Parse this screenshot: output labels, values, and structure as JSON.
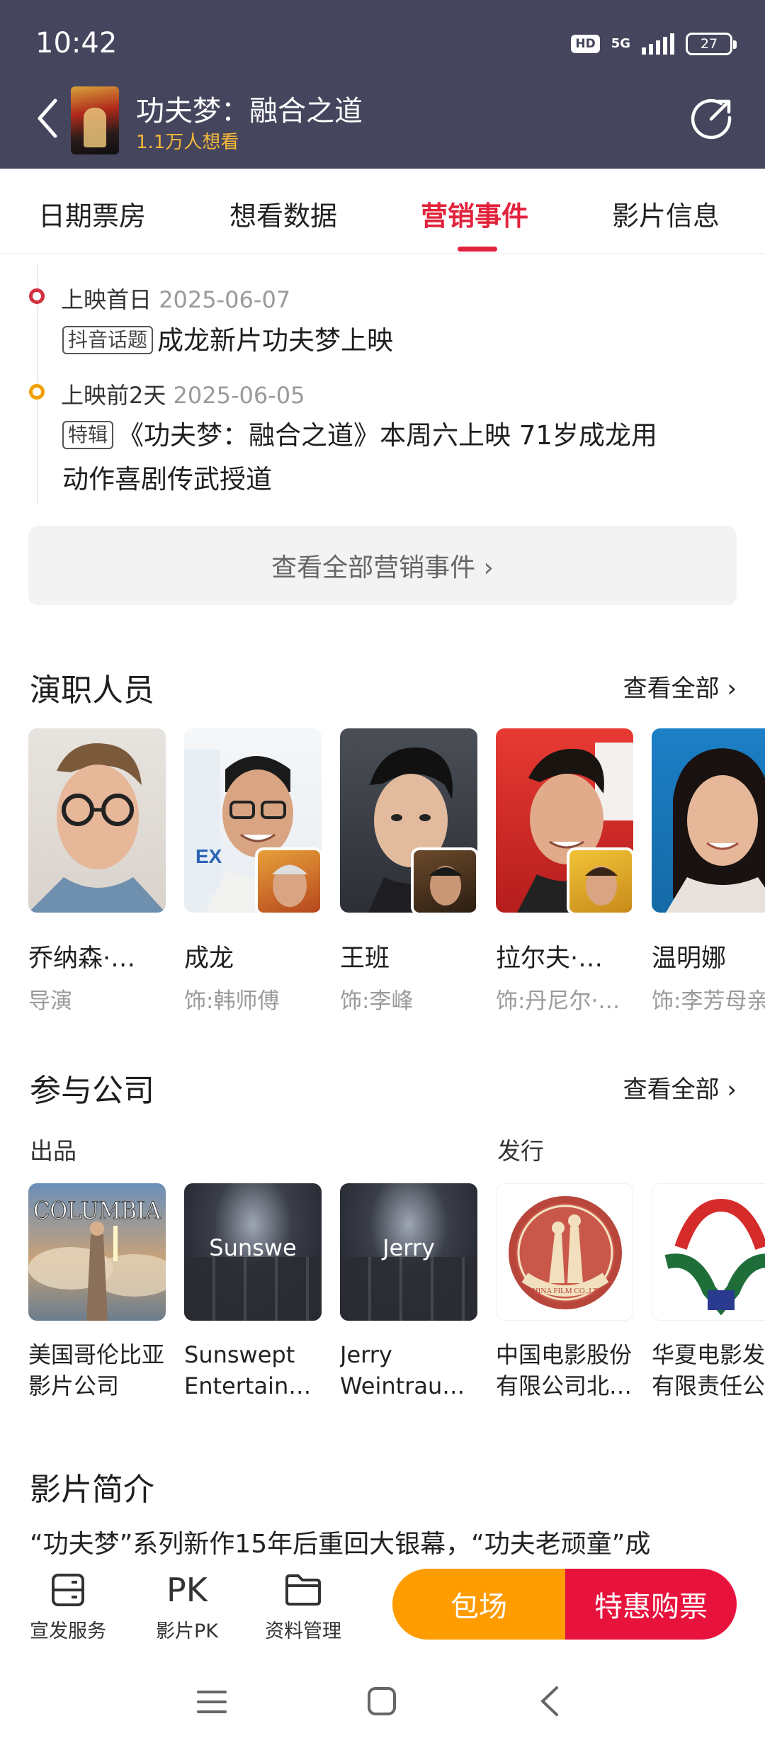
{
  "status_bar": {
    "time": "10:42",
    "network": "5G",
    "battery": "27",
    "hd": "HD"
  },
  "header": {
    "movie_title": "功夫梦：融合之道",
    "want_count": "1.1万人想看"
  },
  "tabs": [
    {
      "label": "日期票房",
      "active": false
    },
    {
      "label": "想看数据",
      "active": false
    },
    {
      "label": "营销事件",
      "active": true
    },
    {
      "label": "影片信息",
      "active": false
    }
  ],
  "events": [
    {
      "stage": "上映首日",
      "date": "2025-06-07",
      "tag": "抖音话题",
      "text": "成龙新片功夫梦上映",
      "dot_color": "#d3303f"
    },
    {
      "stage": "上映前2天",
      "date": "2025-06-05",
      "tag": "特辑",
      "text_line1": "《功夫梦：融合之道》本周六上映 71岁成龙用",
      "text_line2": "动作喜剧传武授道",
      "dot_color": "#f0a000"
    }
  ],
  "view_all_events": "查看全部营销事件 ›",
  "cast_section": {
    "title": "演职人员",
    "view_all": "查看全部 ›",
    "members": [
      {
        "name": "乔纳森·…",
        "role": "导演"
      },
      {
        "name": "成龙",
        "role": "饰:韩师傅"
      },
      {
        "name": "王班",
        "role": "饰:李峰"
      },
      {
        "name": "拉尔夫·…",
        "role": "饰:丹尼尔·…"
      },
      {
        "name": "温明娜",
        "role": "饰:李芳母亲"
      }
    ]
  },
  "company_section": {
    "title": "参与公司",
    "view_all": "查看全部 ›",
    "production_label": "出品",
    "distribution_label": "发行",
    "companies": [
      {
        "line1": "美国哥伦比亚",
        "line2": "影片公司",
        "logo_text": "COLUMBIA"
      },
      {
        "line1": "Sunswept",
        "line2": "Entertain…",
        "logo_text": "Sunswe"
      },
      {
        "line1": "Jerry",
        "line2": "Weintraub…",
        "logo_text": "Jerry"
      },
      {
        "line1": "中国电影股份",
        "line2": "有限公司北…",
        "logo_text": "CHINA FILM CO.,LTD"
      },
      {
        "line1": "华夏电影发",
        "line2": "有限责任公",
        "logo_text": ""
      }
    ]
  },
  "synopsis": {
    "title": "影片简介",
    "text": "“功夫梦”系列新作15年后重回大银幕，“功夫老顽童”成"
  },
  "action_bar": {
    "items": [
      {
        "label": "宣发服务",
        "icon": "promo-service-icon"
      },
      {
        "label": "影片PK",
        "icon": "pk-icon",
        "glyph": "PK"
      },
      {
        "label": "资料管理",
        "icon": "folder-icon"
      }
    ],
    "booking_label": "包场",
    "buy_label": "特惠购票",
    "colors": {
      "booking": "#ff9c00",
      "buy": "#e8133d"
    }
  },
  "colors": {
    "header_bg": "#45455d",
    "accent": "#e2233c",
    "gold": "#f5b83a"
  }
}
